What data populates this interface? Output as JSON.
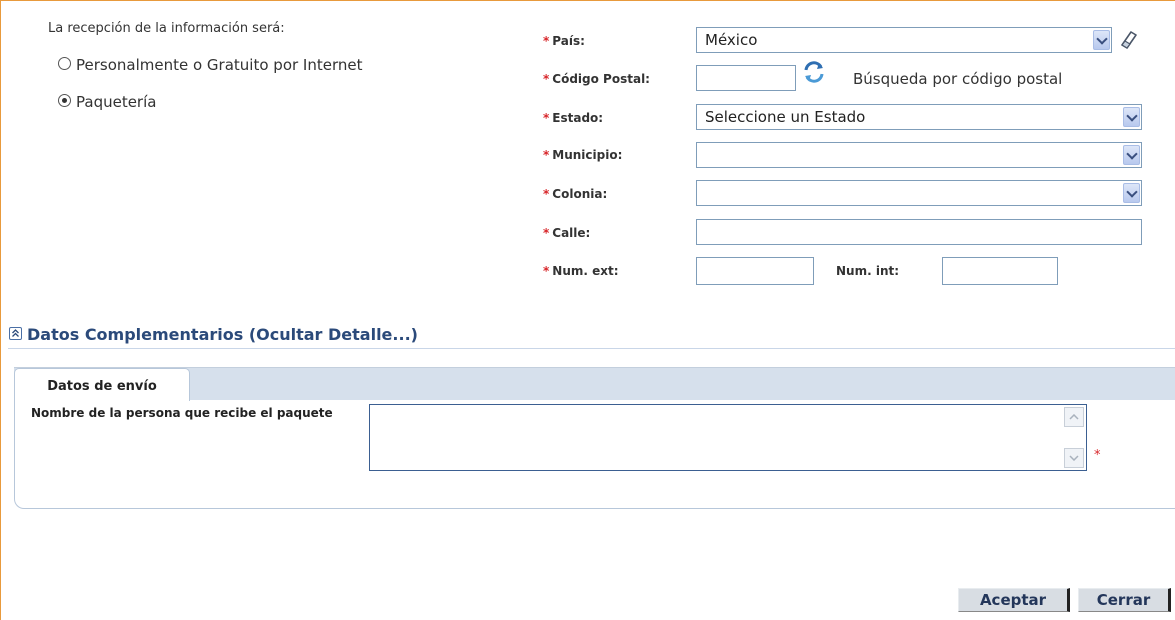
{
  "reception": {
    "heading": "La recepción de la información será:",
    "options": [
      {
        "label": "Personalmente o Gratuito por Internet",
        "selected": false
      },
      {
        "label": "Paquetería",
        "selected": true
      }
    ]
  },
  "address": {
    "required_mark": "*",
    "pais": {
      "label": "País:",
      "value": "México"
    },
    "cp": {
      "label": "Código Postal:",
      "value": "",
      "search_link": "Búsqueda por código postal"
    },
    "estado": {
      "label": "Estado:",
      "value": "Seleccione un Estado"
    },
    "municipio": {
      "label": "Municipio:",
      "value": ""
    },
    "colonia": {
      "label": "Colonia:",
      "value": ""
    },
    "calle": {
      "label": "Calle:",
      "value": ""
    },
    "num_ext": {
      "label": "Num. ext:",
      "value": ""
    },
    "num_int": {
      "label": "Num. int:",
      "value": ""
    }
  },
  "section": {
    "title": "Datos Complementarios (Ocultar Detalle...)"
  },
  "tabs": [
    {
      "label": "Datos de envío",
      "active": true
    }
  ],
  "shipping": {
    "recipient_label": "Nombre de la persona que recibe el paquete",
    "recipient_value": "",
    "required_mark": "*"
  },
  "actions": {
    "accept": "Aceptar",
    "close": "Cerrar"
  },
  "colors": {
    "frame": "#e89a3c",
    "required": "#d8262a",
    "section_title": "#2b4a7a",
    "tab_strip": "#d6e0ec"
  }
}
